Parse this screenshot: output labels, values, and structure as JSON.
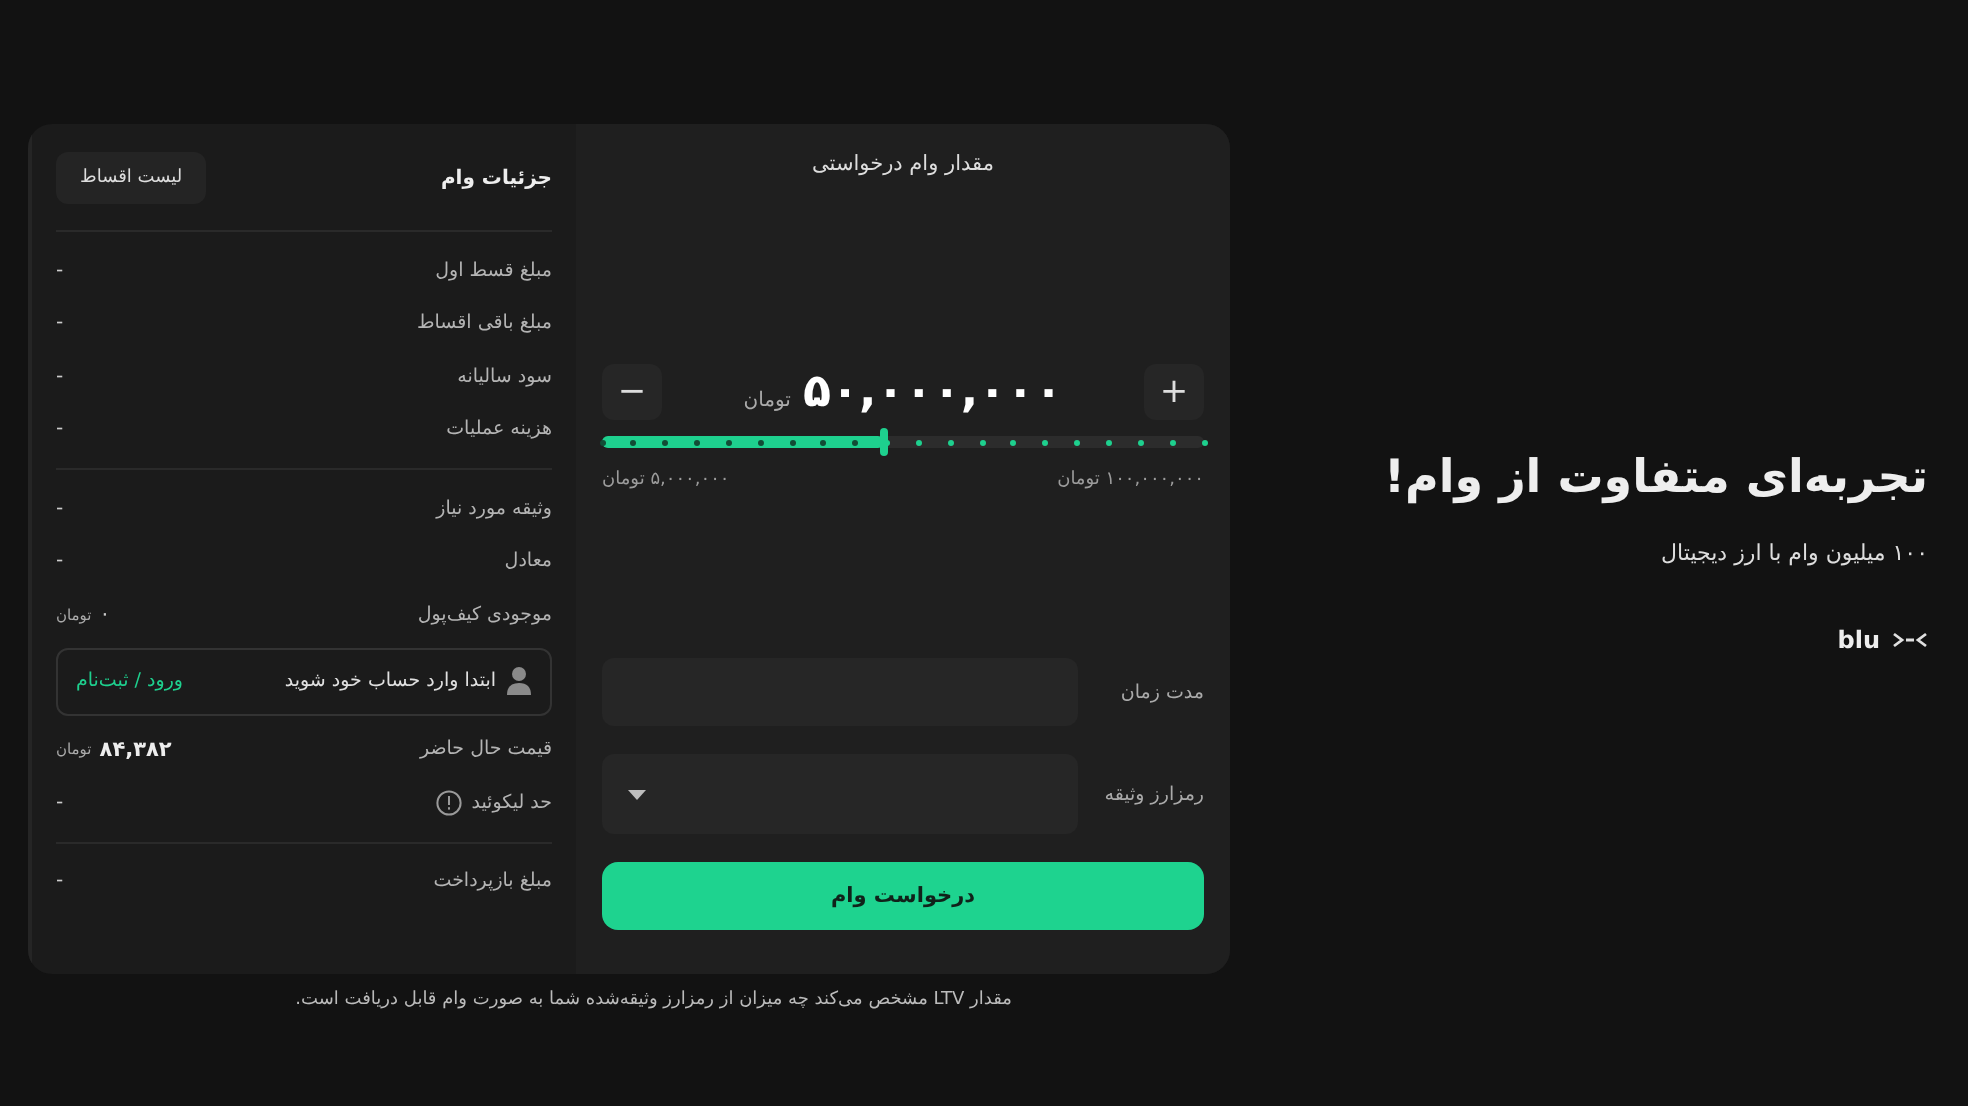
{
  "details": {
    "title": "جزئیات وام",
    "list_button": "لیست اقساط",
    "groups": [
      [
        {
          "kind": "row",
          "label": "مبلغ قسط اول",
          "value": "-"
        },
        {
          "kind": "row",
          "label": "مبلغ باقی اقساط",
          "value": "-"
        },
        {
          "kind": "row",
          "label": "سود سالیانه",
          "value": "-"
        },
        {
          "kind": "row",
          "label": "هزینه عملیات",
          "value": "-"
        }
      ],
      [
        {
          "kind": "row",
          "label": "وثیقه مورد نیاز",
          "value": "-"
        },
        {
          "kind": "row",
          "label": "معادل",
          "value": "-"
        },
        {
          "kind": "row",
          "label": "موجودی کیف‌پول",
          "value": "۰",
          "unit": "تومان"
        },
        {
          "kind": "login",
          "text": "ابتدا وارد حساب خود شوید",
          "link": "ورود / ثبت‌نام"
        },
        {
          "kind": "row",
          "label": "قیمت حال حاضر",
          "value": "۸۴,۳۸۲",
          "unit": "تومان",
          "bold": true
        },
        {
          "kind": "row",
          "label": "حد لیکوئید",
          "value": "-",
          "info": true
        }
      ],
      [
        {
          "kind": "row",
          "label": "مبلغ بازپرداخت",
          "value": "-"
        }
      ]
    ]
  },
  "request": {
    "title": "مقدار وام درخواستی",
    "amount": "۵۰,۰۰۰,۰۰۰",
    "unit": "تومان",
    "minus": "−",
    "plus": "+",
    "level": 0.47,
    "min_label": "۵,۰۰۰,۰۰۰ تومان",
    "max_label": "۱۰۰,۰۰۰,۰۰۰ تومان",
    "fields": [
      {
        "kind": "input",
        "label": "مدت زمان"
      },
      {
        "kind": "select",
        "label": "رمزارز وثیقه"
      }
    ],
    "submit": "درخواست وام"
  },
  "footnote": "مقدار LTV مشخص می‌کند چه میزان از رمزارز وثیقه‌شده شما به صورت وام قابل دریافت است.",
  "hero": {
    "title": "تجربه‌ای متفاوت از وام!",
    "subtitle": "۱۰۰ میلیون وام با ارز دیجیتال",
    "logo": "blu"
  }
}
